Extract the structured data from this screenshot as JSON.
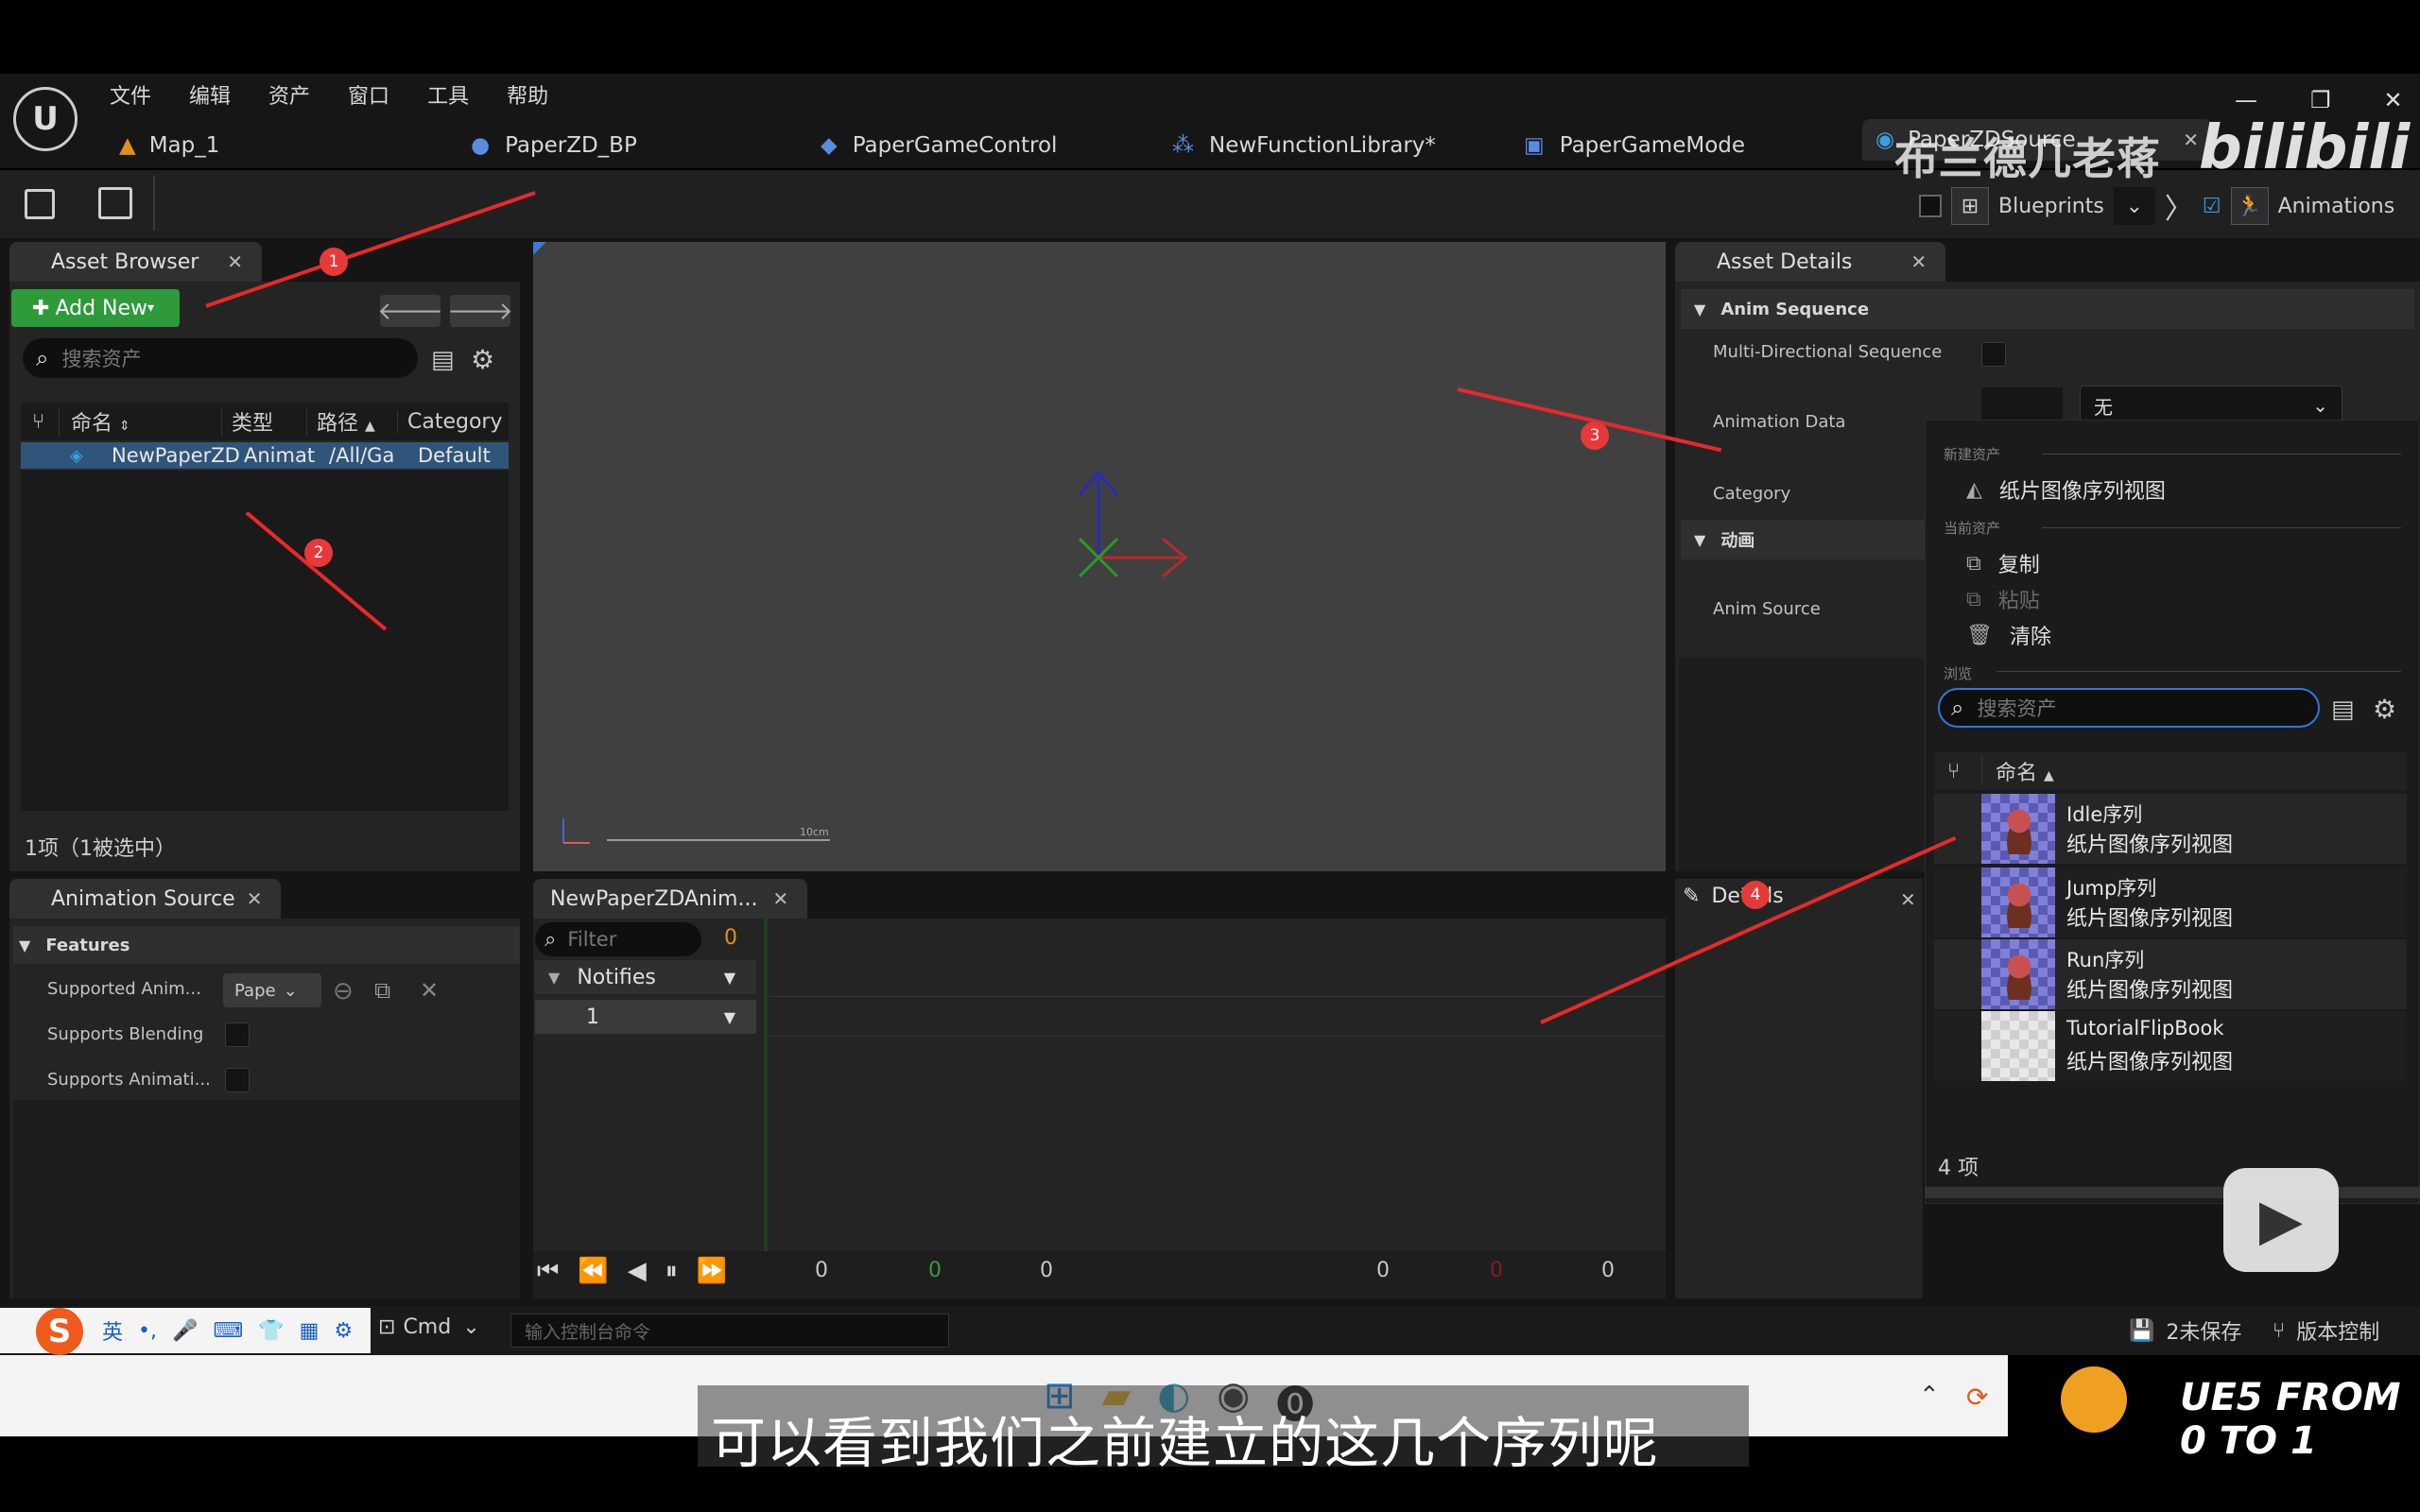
{
  "menu": [
    "文件",
    "编辑",
    "资产",
    "窗口",
    "工具",
    "帮助"
  ],
  "tabs": [
    "Map_1",
    "PaperZD_BP",
    "PaperGameControl",
    "NewFunctionLibrary*",
    "PaperGameMode",
    "PaperZDSource"
  ],
  "toolbar": {
    "blueprints": "Blueprints",
    "animations": "Animations"
  },
  "watermark": {
    "author": "布兰德几老蒋",
    "brand": "bilibili"
  },
  "asset_browser": {
    "title": "Asset Browser",
    "add_new": "Add New",
    "search_placeholder": "搜索资产",
    "columns": [
      "命名",
      "类型",
      "路径",
      "Category"
    ],
    "row": {
      "name": "NewPaperZD",
      "type": "Animat",
      "path": "/All/Ga",
      "category": "Default"
    },
    "footer": "1项（1被选中）"
  },
  "asset_details": {
    "title": "Asset Details",
    "section1": "Anim Sequence",
    "multi_dir": "Multi-Directional Sequence",
    "animation_data": "Animation Data",
    "dropdown_value": "无",
    "category": "Category",
    "section2": "动画",
    "anim_source": "Anim Source"
  },
  "popup": {
    "new_asset_header": "新建资产",
    "create_item": "纸片图像序列视图",
    "current_asset_header": "当前资产",
    "copy": "复制",
    "paste": "粘贴",
    "clear": "清除",
    "browse_header": "浏览",
    "search_placeholder": "搜索资产",
    "name_col": "命名",
    "items": [
      {
        "name": "Idle序列",
        "type": "纸片图像序列视图"
      },
      {
        "name": "Jump序列",
        "type": "纸片图像序列视图"
      },
      {
        "name": "Run序列",
        "type": "纸片图像序列视图"
      },
      {
        "name": "TutorialFlipBook",
        "type": "纸片图像序列视图"
      }
    ],
    "count": "4 项"
  },
  "anim_source": {
    "title": "Animation Source",
    "features": "Features",
    "supported_anim": "Supported Anim...",
    "pape": "Pape",
    "supports_blending": "Supports Blending",
    "supports_animati": "Supports Animati..."
  },
  "timeline": {
    "title": "NewPaperZDAnim...",
    "filter_placeholder": "Filter",
    "filter_count": "0",
    "notifies": "Notifies",
    "track": "1",
    "numbers": [
      "0",
      "0",
      "0",
      "0",
      "0",
      "0"
    ]
  },
  "viewport": {
    "scale": "10cm"
  },
  "details": {
    "title": "Details"
  },
  "bottom_bar": {
    "cmd": "Cmd",
    "console_placeholder": "输入控制台命令",
    "unsaved": "2未保存",
    "version": "版本控制"
  },
  "ime": {
    "lang": "英"
  },
  "subtitle": "可以看到我们之前建立的这几个序列呢",
  "badge_right": "UE5 FROM 0 TO 1",
  "annotations": [
    "1",
    "2",
    "3",
    "4"
  ],
  "colors": {
    "accent": "#e8292a",
    "add_new": "#2e9a3a",
    "selected_row": "#30557a"
  }
}
